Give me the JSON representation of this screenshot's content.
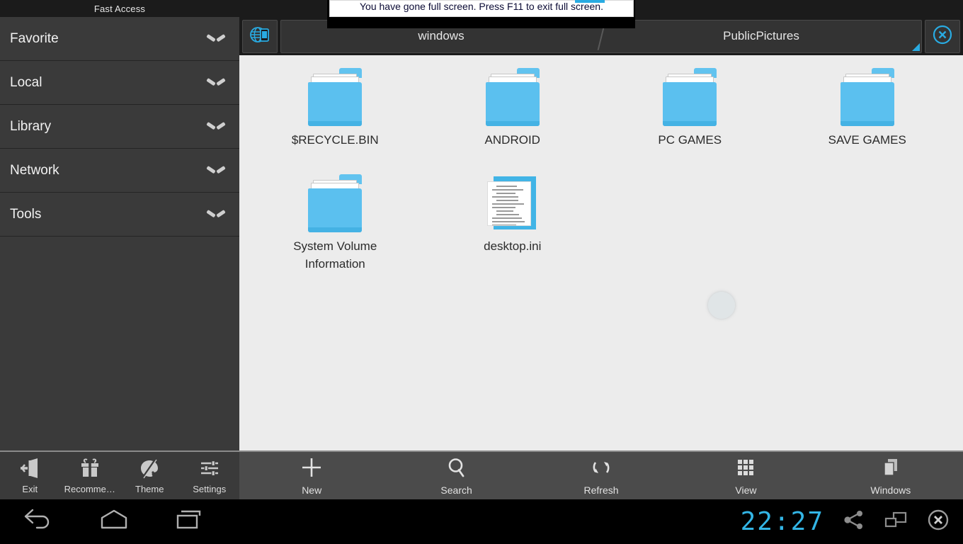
{
  "sidebar": {
    "header": "Fast Access",
    "items": [
      {
        "label": "Favorite",
        "icon": "chevron-down-icon"
      },
      {
        "label": "Local",
        "icon": "chevron-down-icon"
      },
      {
        "label": "Library",
        "icon": "chevron-down-icon"
      },
      {
        "label": "Network",
        "icon": "chevron-down-icon"
      },
      {
        "label": "Tools",
        "icon": "chevron-down-icon"
      }
    ]
  },
  "left_toolbar": {
    "items": [
      {
        "label": "Exit",
        "icon": "exit-icon"
      },
      {
        "label": "Recomme…",
        "icon": "gift-icon"
      },
      {
        "label": "Theme",
        "icon": "palette-icon"
      },
      {
        "label": "Settings",
        "icon": "sliders-icon"
      }
    ]
  },
  "tabbar": {
    "device_icon": "globe-device-icon",
    "close_icon": "close-circle-icon",
    "resize_handle_icon": "resize-handle-icon",
    "tabs": [
      {
        "label": "windows",
        "active": false
      },
      {
        "label": "PublicPictures",
        "active": true
      }
    ]
  },
  "files": [
    {
      "name": "$RECYCLE.BIN",
      "type": "folder",
      "icon": "folder-icon"
    },
    {
      "name": "ANDROID",
      "type": "folder",
      "icon": "folder-icon"
    },
    {
      "name": "PC GAMES",
      "type": "folder",
      "icon": "folder-icon"
    },
    {
      "name": "SAVE GAMES",
      "type": "folder",
      "icon": "folder-icon"
    },
    {
      "name": "System Volume Information",
      "type": "folder",
      "icon": "folder-icon"
    },
    {
      "name": "desktop.ini",
      "type": "file",
      "icon": "ini-file-icon"
    }
  ],
  "right_toolbar": {
    "items": [
      {
        "label": "New",
        "icon": "plus-icon"
      },
      {
        "label": "Search",
        "icon": "search-icon"
      },
      {
        "label": "Refresh",
        "icon": "refresh-icon"
      },
      {
        "label": "View",
        "icon": "grid-icon"
      },
      {
        "label": "Windows",
        "icon": "windows-stack-icon"
      }
    ]
  },
  "navbar": {
    "back_icon": "back-arrow-icon",
    "home_icon": "home-icon",
    "recents_icon": "recents-icon",
    "clock": "22:27",
    "share_icon": "share-icon",
    "window_icon": "window-icon",
    "close_icon": "close-circle-icon"
  },
  "notification": {
    "message": "You have gone full screen. Press F11 to exit full screen."
  },
  "colors": {
    "accent": "#33b5e5",
    "folder_blue": "#5bc0ef",
    "sidebar_bg": "#3a3a3a",
    "content_bg": "#ececec",
    "toolbar_bg": "#4b4b4b"
  }
}
